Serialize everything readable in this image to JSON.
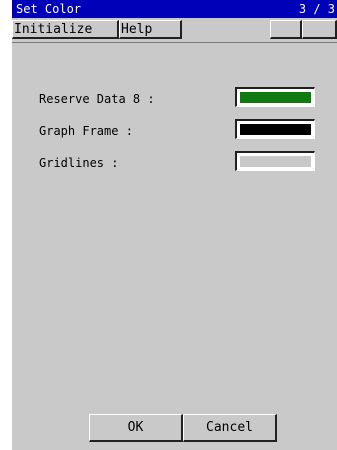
{
  "window": {
    "title": "Set Color",
    "page": "3 / 3"
  },
  "toolbar": {
    "initialize_label": "Initialize",
    "help_label": "Help",
    "prev_icon": "◀",
    "next_icon": "▶"
  },
  "colors": [
    {
      "label": "Reserve Data 8 :",
      "color": "#0f7a0f"
    },
    {
      "label": "Graph Frame :",
      "color": "#000000"
    },
    {
      "label": "Gridlines :",
      "color": "#c8c8c8"
    }
  ],
  "buttons": {
    "ok_label": "OK",
    "cancel_label": "Cancel"
  }
}
